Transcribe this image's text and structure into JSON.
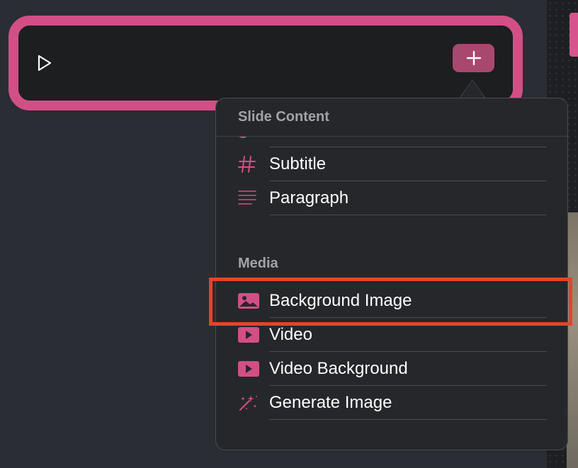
{
  "popover": {
    "sections": [
      {
        "header": "Slide Content",
        "items": [
          {
            "label": "Subtitle",
            "icon": "hash-icon"
          },
          {
            "label": "Paragraph",
            "icon": "paragraph-lines-icon"
          }
        ]
      },
      {
        "header": "Media",
        "items": [
          {
            "label": "Background Image",
            "icon": "image-icon"
          },
          {
            "label": "Video",
            "icon": "video-play-icon"
          },
          {
            "label": "Video Background",
            "icon": "video-play-icon"
          },
          {
            "label": "Generate Image",
            "icon": "magic-sparkles-icon"
          }
        ]
      }
    ]
  },
  "slide": {
    "play_icon": "play-icon",
    "add_icon": "plus-icon"
  },
  "highlighted_item": "Background Image",
  "colors": {
    "accent_pink": "#d24f86",
    "add_button": "#a9486f",
    "highlight_red": "#e4432c",
    "popover_bg": "#26272a",
    "slide_bg": "#1d1e20",
    "page_bg": "#2a2d33",
    "header_text": "#a2a3a8",
    "item_text": "#ffffff"
  }
}
